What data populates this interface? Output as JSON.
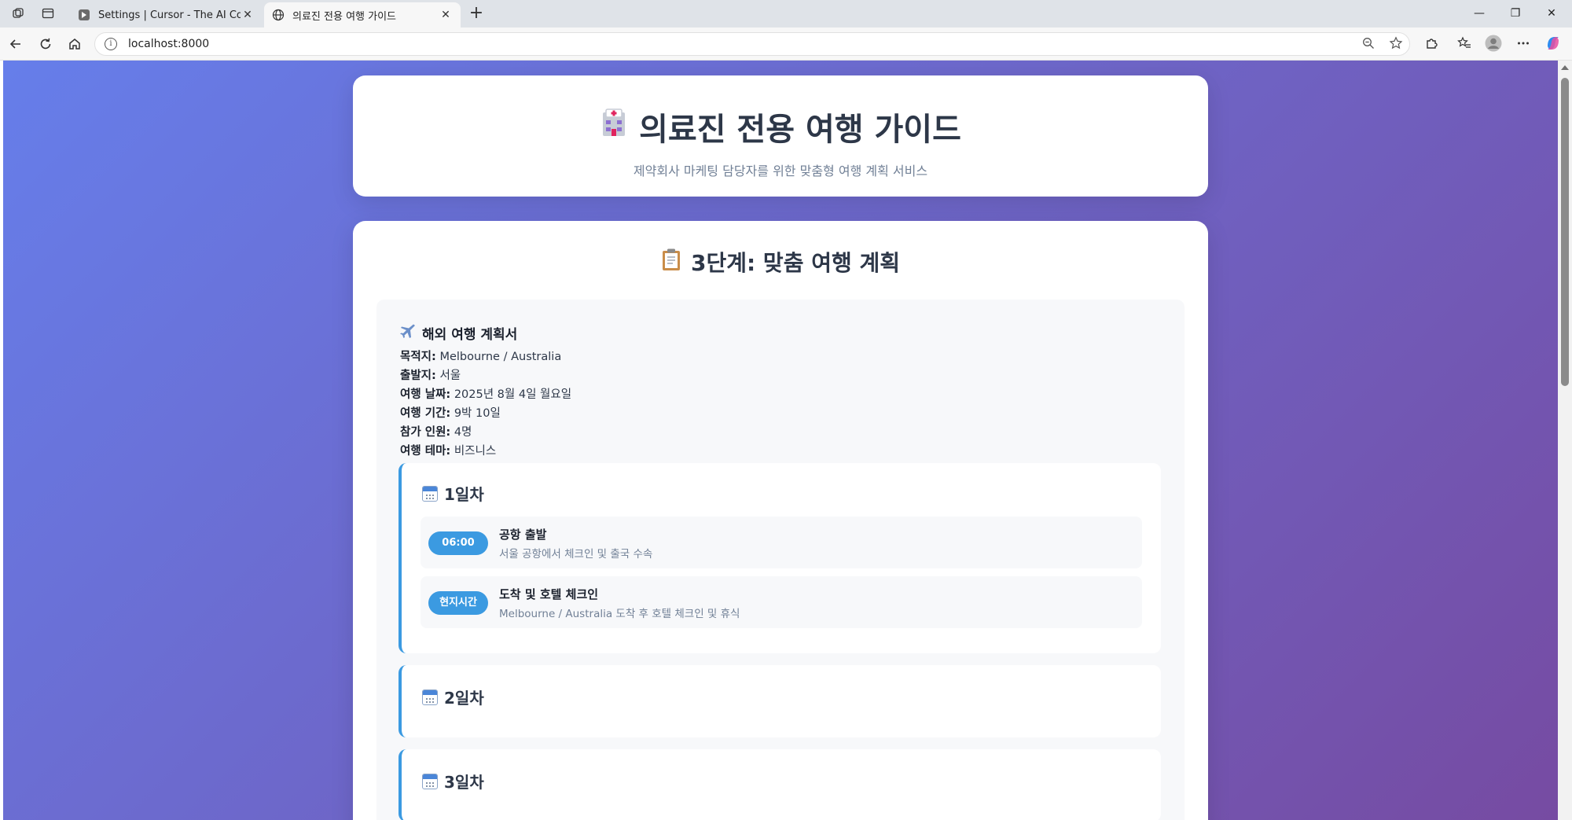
{
  "browser": {
    "tabs": [
      {
        "title": "Settings | Cursor - The AI Code Ed",
        "active": false
      },
      {
        "title": "의료진 전용 여행 가이드",
        "active": true
      }
    ],
    "address": "localhost:8000"
  },
  "header": {
    "icon": "hospital-icon",
    "title": "의료진 전용 여행 가이드",
    "subtitle": "제약회사 마케팅 담당자를 위한 맞춤형 여행 계획 서비스"
  },
  "step": {
    "icon": "clipboard-icon",
    "title": "3단계: 맞춤 여행 계획"
  },
  "plan": {
    "icon": "airplane-icon",
    "title": "해외 여행 계획서",
    "fields": [
      {
        "label": "목적지:",
        "value": "Melbourne / Australia"
      },
      {
        "label": "출발지:",
        "value": "서울"
      },
      {
        "label": "여행 날짜:",
        "value": "2025년 8월 4일 월요일"
      },
      {
        "label": "여행 기간:",
        "value": "9박 10일"
      },
      {
        "label": "참가 인원:",
        "value": "4명"
      },
      {
        "label": "여행 테마:",
        "value": "비즈니스"
      }
    ]
  },
  "days": [
    {
      "title": "1일차",
      "events": [
        {
          "time": "06:00",
          "title": "공항 출발",
          "desc": "서울 공항에서 체크인 및 출국 수속"
        },
        {
          "time": "현지시간",
          "title": "도착 및 호텔 체크인",
          "desc": "Melbourne / Australia 도착 후 호텔 체크인 및 휴식"
        }
      ]
    },
    {
      "title": "2일차",
      "events": []
    },
    {
      "title": "3일차",
      "events": []
    }
  ],
  "colors": {
    "gradient_start": "#667eea",
    "gradient_end": "#764ba2",
    "accent": "#3b9ae1"
  }
}
